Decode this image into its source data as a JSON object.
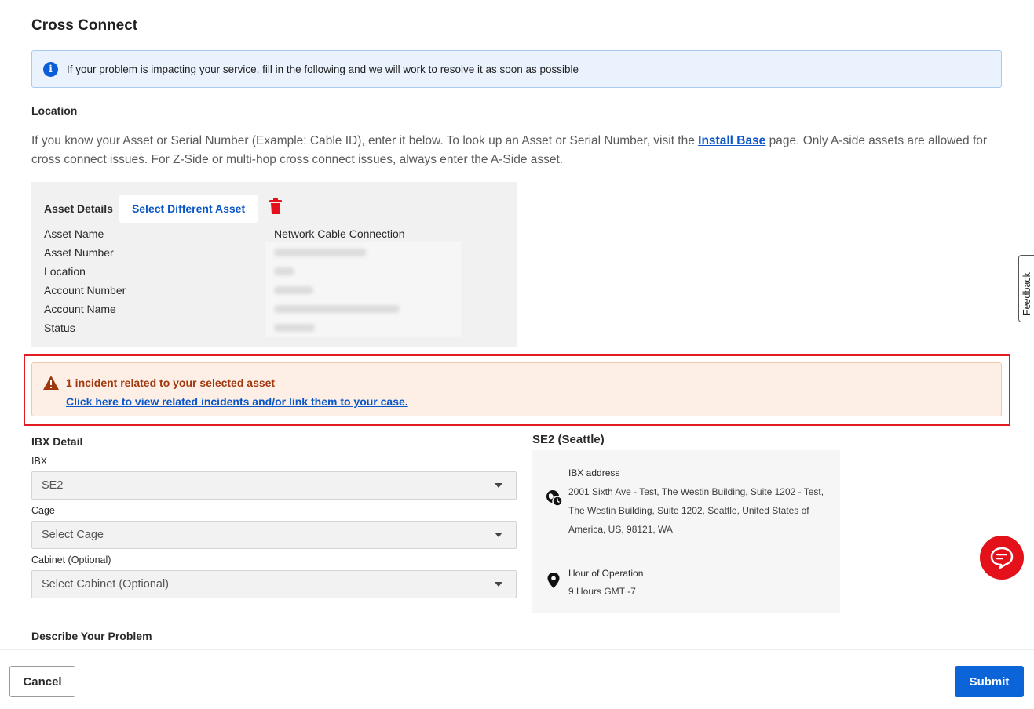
{
  "page": {
    "title": "Cross Connect"
  },
  "info_banner": {
    "icon": "info-icon",
    "text": "If your problem is impacting your service, fill in the following and we will work to resolve it as soon as possible"
  },
  "location": {
    "label": "Location",
    "desc_part1": "If you know your Asset or Serial Number (Example: Cable ID), enter it below. To look up an Asset or Serial Number, visit the ",
    "link": "Install Base",
    "desc_part2": " page. Only A-side assets are allowed for cross connect issues. For Z-Side or multi-hop cross connect issues, always enter the A-Side asset."
  },
  "asset": {
    "header_label": "Asset Details",
    "select_button": "Select Different Asset",
    "rows": [
      {
        "key": "Asset Name",
        "value": "Network Cable Connection"
      },
      {
        "key": "Asset Number",
        "value": ""
      },
      {
        "key": "Location",
        "value": ""
      },
      {
        "key": "Account Number",
        "value": ""
      },
      {
        "key": "Account Name",
        "value": ""
      },
      {
        "key": "Status",
        "value": ""
      }
    ]
  },
  "alert": {
    "title": "1 incident related to your selected asset",
    "link": "Click here to view related incidents and/or link them to your case."
  },
  "ibx_detail": {
    "label": "IBX Detail",
    "ibx_label": "IBX",
    "ibx_value": "SE2",
    "cage_label": "Cage",
    "cage_placeholder": "Select Cage",
    "cabinet_label": "Cabinet (Optional)",
    "cabinet_placeholder": "Select Cabinet (Optional)"
  },
  "ibx_card": {
    "heading": "SE2 (Seattle)",
    "address_label": "IBX address",
    "address": "2001 Sixth Ave - Test, The Westin Building, Suite 1202 - Test, The Westin Building, Suite 1202, Seattle, United States of America, US, 98121, WA",
    "hours_label": "Hour of Operation",
    "hours": "9 Hours GMT -7"
  },
  "describe": {
    "label": "Describe Your Problem"
  },
  "feedback": {
    "label": "Feedback"
  },
  "footer": {
    "cancel": "Cancel",
    "submit": "Submit"
  },
  "colors": {
    "accent": "#0b64d8",
    "alert_red": "#e11b22",
    "warning": "#a0370d",
    "trash": "#e4111b"
  }
}
